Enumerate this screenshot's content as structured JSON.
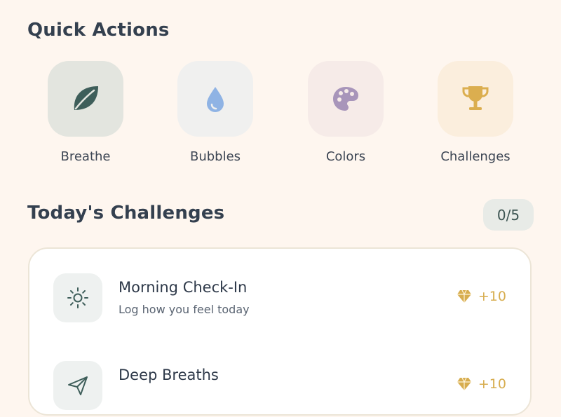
{
  "quick_actions": {
    "title": "Quick Actions",
    "items": [
      {
        "label": "Breathe",
        "icon": "leaf-icon",
        "bg": "#e3e5df",
        "color": "#3e5e5a"
      },
      {
        "label": "Bubbles",
        "icon": "water-drop-icon",
        "bg": "#f0f0ef",
        "color": "#8fb3e4"
      },
      {
        "label": "Colors",
        "icon": "palette-icon",
        "bg": "#f6ebe8",
        "color": "#a895ba"
      },
      {
        "label": "Challenges",
        "icon": "trophy-icon",
        "bg": "#fbeedd",
        "color": "#dbae4f"
      }
    ]
  },
  "todays_challenges": {
    "title": "Today's Challenges",
    "progress": "0/5",
    "items": [
      {
        "title": "Morning Check-In",
        "description": "Log how you feel today",
        "reward": "+10",
        "icon": "sun-icon"
      },
      {
        "title": "Deep Breaths",
        "description": "",
        "reward": "+10",
        "icon": "send-icon"
      }
    ]
  },
  "colors": {
    "background": "#fef6ef",
    "accent_gold": "#d7ad4f",
    "accent_teal": "#3e5e5a"
  }
}
